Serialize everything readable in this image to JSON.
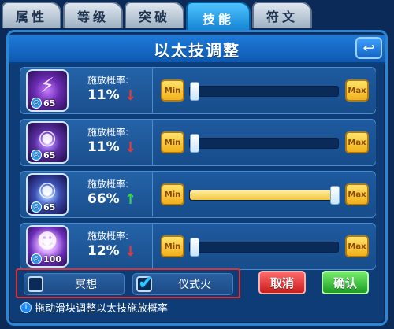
{
  "tabs": [
    {
      "label": "属性"
    },
    {
      "label": "等级"
    },
    {
      "label": "突破"
    },
    {
      "label": "技能"
    },
    {
      "label": "符文"
    }
  ],
  "active_tab_index": 3,
  "title": "以太技调整",
  "back_icon": "back-arrow-icon",
  "min_label": "Min",
  "max_label": "Max",
  "skills": [
    {
      "level": "65",
      "prob_label": "施放概率:",
      "prob_value": "11%",
      "trend": "down",
      "trend_symbol": "↓",
      "slider_fraction": 0.0,
      "icon": "claw-slash-icon"
    },
    {
      "level": "65",
      "prob_label": "施放概率:",
      "prob_value": "11%",
      "trend": "down",
      "trend_symbol": "↓",
      "slider_fraction": 0.0,
      "icon": "violet-vortex-icon"
    },
    {
      "level": "65",
      "prob_label": "施放概率:",
      "prob_value": "66%",
      "trend": "up",
      "trend_symbol": "↑",
      "slider_fraction": 1.0,
      "icon": "blue-vortex-icon"
    },
    {
      "level": "100",
      "prob_label": "施放概率:",
      "prob_value": "12%",
      "trend": "down",
      "trend_symbol": "↓",
      "slider_fraction": 0.0,
      "icon": "mask-face-icon"
    }
  ],
  "options": [
    {
      "label": "冥想",
      "checked": false
    },
    {
      "label": "仪式火",
      "checked": true
    }
  ],
  "cancel_label": "取消",
  "confirm_label": "确认",
  "hint": "拖动滑块调整以太技施放概率",
  "colors": {
    "highlight_border": "#e03030",
    "down_arrow": "#e83a3a",
    "up_arrow": "#37d84c",
    "slider_fill": "#f5c23c"
  }
}
